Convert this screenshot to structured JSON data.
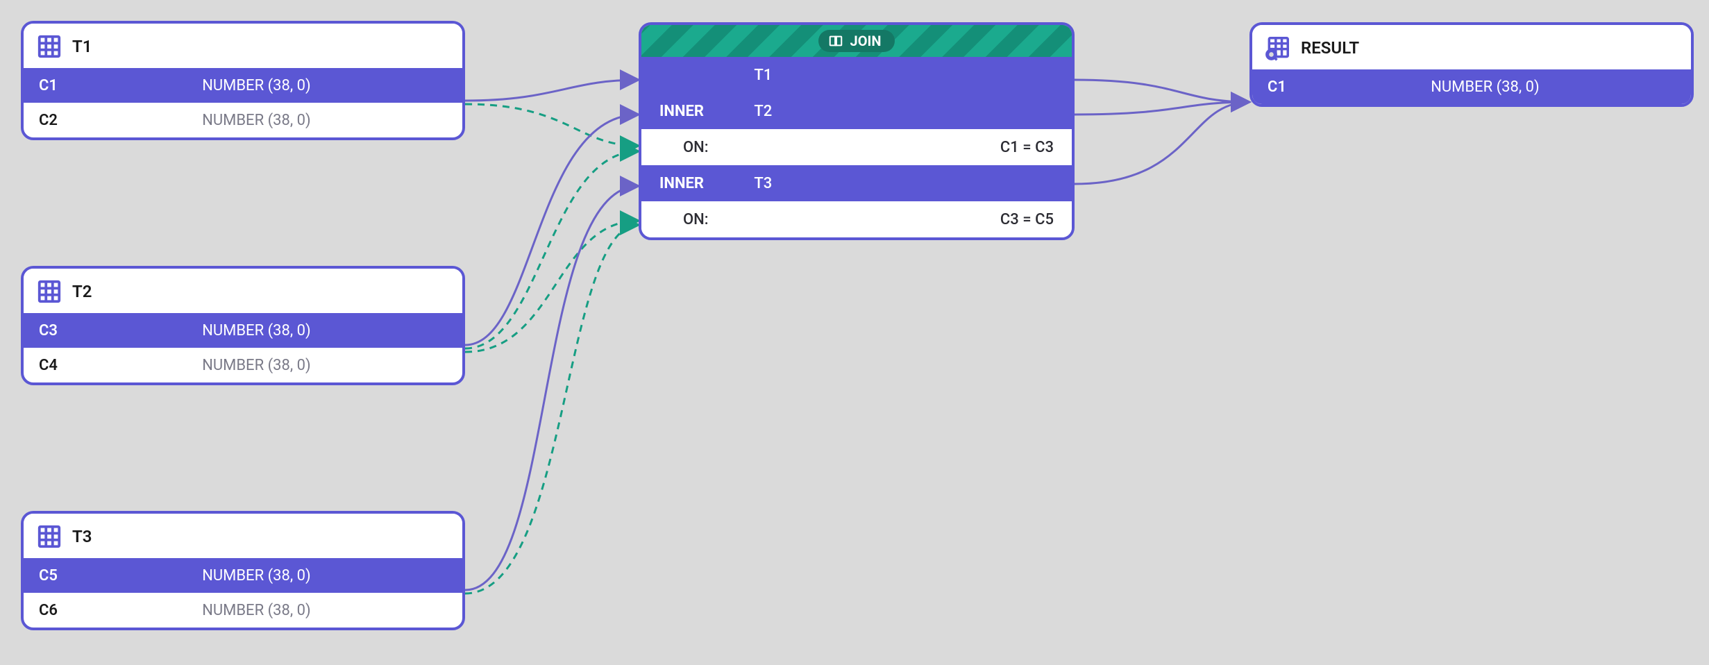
{
  "tables": {
    "t1": {
      "name": "T1",
      "rows": [
        {
          "col": "C1",
          "type": "NUMBER (38, 0)",
          "highlight": true
        },
        {
          "col": "C2",
          "type": "NUMBER (38, 0)",
          "highlight": false
        }
      ]
    },
    "t2": {
      "name": "T2",
      "rows": [
        {
          "col": "C3",
          "type": "NUMBER (38, 0)",
          "highlight": true
        },
        {
          "col": "C4",
          "type": "NUMBER (38, 0)",
          "highlight": false
        }
      ]
    },
    "t3": {
      "name": "T3",
      "rows": [
        {
          "col": "C5",
          "type": "NUMBER (38, 0)",
          "highlight": true
        },
        {
          "col": "C6",
          "type": "NUMBER (38, 0)",
          "highlight": false
        }
      ]
    }
  },
  "join": {
    "label": "JOIN",
    "rows": [
      {
        "kind": "base",
        "left": "",
        "mid": "T1",
        "right": ""
      },
      {
        "kind": "inner",
        "left": "INNER",
        "mid": "T2",
        "right": ""
      },
      {
        "kind": "on",
        "left": "ON:",
        "mid": "",
        "right": "C1 = C3"
      },
      {
        "kind": "inner",
        "left": "INNER",
        "mid": "T3",
        "right": ""
      },
      {
        "kind": "on",
        "left": "ON:",
        "mid": "",
        "right": "C3 = C5"
      }
    ]
  },
  "result": {
    "name": "RESULT",
    "rows": [
      {
        "col": "C1",
        "type": "NUMBER (38, 0)",
        "highlight": true
      }
    ]
  },
  "colors": {
    "accent": "#5B57D4",
    "teal": "#169E83"
  }
}
